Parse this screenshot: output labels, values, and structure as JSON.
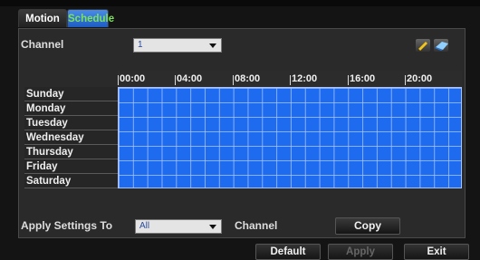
{
  "tabs": [
    {
      "label": "Motion",
      "active": false
    },
    {
      "label": "Schedule",
      "active": true
    }
  ],
  "channel": {
    "label": "Channel",
    "value": "1"
  },
  "tools": {
    "edit_icon": "pencil-icon",
    "erase_icon": "eraser-icon"
  },
  "schedule": {
    "hours": [
      "00:00",
      "04:00",
      "08:00",
      "12:00",
      "16:00",
      "20:00"
    ],
    "days": [
      "Sunday",
      "Monday",
      "Tuesday",
      "Wednesday",
      "Thursday",
      "Friday",
      "Saturday"
    ],
    "all_slots_selected": true,
    "fill_color": "#1f6bf0"
  },
  "apply": {
    "label": "Apply Settings To",
    "value": "All",
    "suffix": "Channel",
    "copy_label": "Copy"
  },
  "footer": {
    "default_label": "Default",
    "apply_label": "Apply",
    "exit_label": "Exit"
  }
}
